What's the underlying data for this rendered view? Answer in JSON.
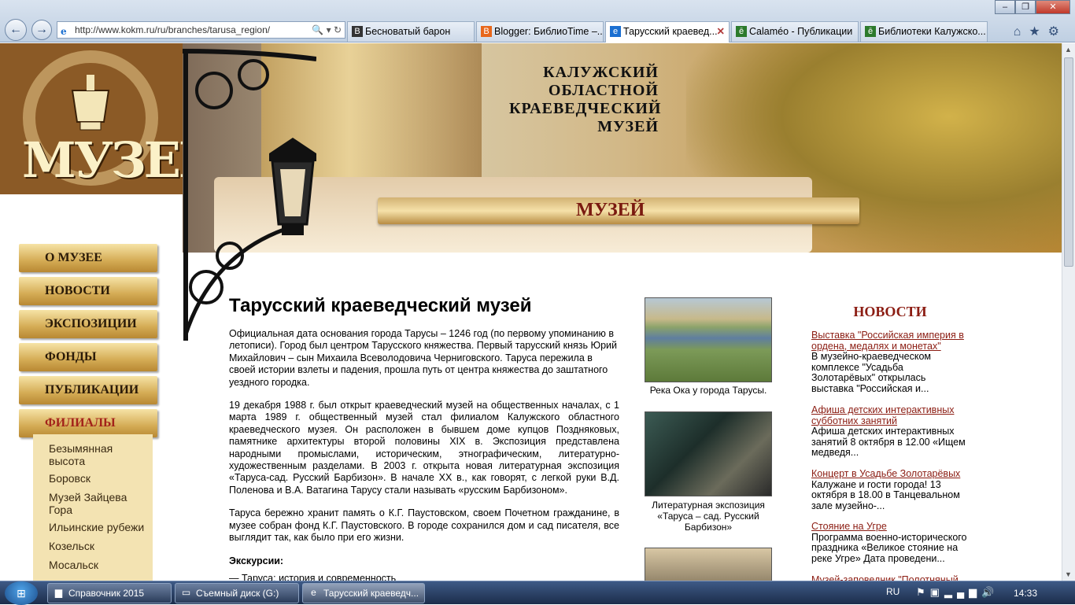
{
  "browser": {
    "url": "http://www.kokm.ru/ru/branches/tarusa_region/",
    "tabs": [
      {
        "label": "Бесноватый барон",
        "icon": "B",
        "color": "#333333",
        "active": false
      },
      {
        "label": "Blogger: БиблиоTime –...",
        "icon": "B",
        "color": "#e8671b",
        "active": false
      },
      {
        "label": "Тарусский краевед...",
        "icon": "e",
        "color": "#1b6fd1",
        "active": true
      },
      {
        "label": "Calaméo - Публикации",
        "icon": "ē",
        "color": "#2c7a2c",
        "active": false
      },
      {
        "label": "Библиотеки Калужско...",
        "icon": "ē",
        "color": "#2c7a2c",
        "active": false
      }
    ]
  },
  "site": {
    "logo_word": "МУЗЕЙ",
    "logo_ring": "КАЛУЖСКИЙ ОБЛАСТНОЙ КРАЕВЕДЧЕСКИЙ",
    "museum_name": [
      "КАЛУЖСКИЙ",
      "ОБЛАСТНОЙ",
      "КРАЕВЕДЧЕСКИЙ",
      "МУЗЕЙ"
    ],
    "ribbon": "МУЗЕЙ"
  },
  "menu": [
    {
      "label": "О МУЗЕЕ",
      "current": false
    },
    {
      "label": "НОВОСТИ",
      "current": false
    },
    {
      "label": "ЭКСПОЗИЦИИ",
      "current": false
    },
    {
      "label": "ФОНДЫ",
      "current": false
    },
    {
      "label": "ПУБЛИКАЦИИ",
      "current": false
    },
    {
      "label": "ФИЛИАЛЫ",
      "current": true
    }
  ],
  "submenu": [
    "Безымянная высота",
    "Боровск",
    "Музей Зайцева Гора",
    "Ильинские рубежи",
    "Козельск",
    "Мосальск"
  ],
  "content": {
    "title": "Тарусский краеведческий музей",
    "p1": "Официальная дата основания города Тарусы – 1246 год (по первому упоминанию в летописи). Город был центром Тарусского княжества. Первый тарусский князь Юрий Михайлович – сын Михаила Всеволодовича Черниговского. Таруса пережила в своей истории взлеты и падения, прошла путь от центра княжества до заштатного уездного городка.",
    "p2": "19 декабря 1988 г. был открыт краеведческий музей на общественных началах, с 1 марта 1989 г. общественный музей стал филиалом Калужского областного краеведческого музея. Он расположен в бывшем доме купцов Поздняковых, памятнике архитектуры второй половины XIX в. Экспозиция представлена народными промыслами, историческим, этнографическим, литературно-художественным разделами. В 2003 г. открыта новая  литературная экспозиция «Таруса-сад. Русский Барбизон». В начале XX в., как говорят, с легкой руки В.Д. Поленова и В.А. Ватагина Тарусу стали называть «русским Барбизоном».",
    "p3": "Таруса бережно хранит память о К.Г. Паустовском, своем Почетном гражданине, в музее собран фонд К.Г. Паустовского. В городе сохранился дом и сад писателя, все выглядит так, как было при его жизни.",
    "excursions_label": "Экскурсии:",
    "excursion1": "— Таруса: история и современность"
  },
  "photos": [
    {
      "caption": "Река Ока у города Тарусы."
    },
    {
      "caption": "Литературная экспозиция «Таруса – сад. Русский Барбизон»"
    }
  ],
  "news": {
    "heading": "НОВОСТИ",
    "items": [
      {
        "title": "Выставка \"Российская империя в ордена, медалях и монетах\"",
        "text": "В музейно-краеведческом комплексе  \"Усадьба Золотарёвых\" открылась выставка \"Российская и..."
      },
      {
        "title": "Афиша детских интерактивных субботних занятий",
        "text": "Афиша детских интерактивных занятий   8 октября в 12.00 «Ищем медведя..."
      },
      {
        "title": "Концерт в Усадьбе Золотарёвых",
        "text": "Калужане и гости города!  13 октября в 18.00  в Танцевальном зале музейно-..."
      },
      {
        "title": "Стояние на Угре",
        "text": "Программа военно-исторического праздника «Великое стояние на реке Угре» Дата проведени..."
      },
      {
        "title": "Музей-заповедник \"Полотняный",
        "text": ""
      }
    ]
  },
  "taskbar": {
    "items": [
      {
        "label": "Справочник 2015",
        "icon": "▆",
        "active": false
      },
      {
        "label": "Съемный диск (G:)",
        "icon": "▭",
        "active": false
      },
      {
        "label": "Тарусский краеведч...",
        "icon": "e",
        "active": true
      }
    ],
    "lang": "RU",
    "time": "14:33"
  }
}
